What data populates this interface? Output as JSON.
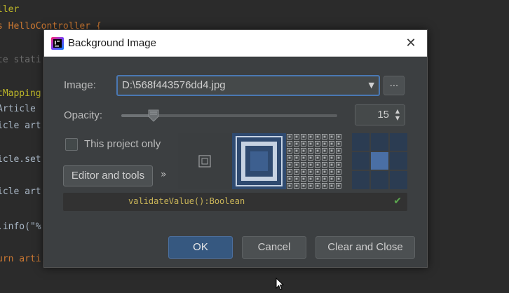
{
  "editor": {
    "lines": [
      {
        "prefix_class": "ann",
        "text": "ller"
      },
      {
        "prefix_class": "kw",
        "text": "s HelloController {"
      },
      {
        "prefix_class": "faded",
        "text": "te stati"
      },
      {
        "prefix_class": "ann",
        "text": "tMapping"
      },
      {
        "prefix_class": "",
        "text": "Article "
      },
      {
        "prefix_class": "",
        "text": "icle art"
      },
      {
        "prefix_class": "",
        "text": "icle.set"
      },
      {
        "prefix_class": "",
        "text": "icle art"
      },
      {
        "prefix_class": "",
        "text": ".info(\"%"
      },
      {
        "prefix_class": "kw",
        "text": "urn arti"
      }
    ]
  },
  "dialog": {
    "title": "Background Image",
    "close_glyph": "✕",
    "icon": "intellij-app-icon",
    "image_label": "Image:",
    "image_value": "D:\\568f443576dd4.jpg",
    "browse_label": "...",
    "opacity_label": "Opacity:",
    "opacity_value": "15",
    "opacity_fraction": 0.15,
    "this_project_only_label": "This project only",
    "this_project_only_checked": false,
    "editor_tools_label": "Editor and tools",
    "chevron_glyph": "»",
    "preview_code": "validateValue():Boolean",
    "ok_label": "OK",
    "cancel_label": "Cancel",
    "clear_close_label": "Clear and Close"
  },
  "colors": {
    "editor_bg": "#2b2b2b",
    "dialog_bg": "#3c3f41",
    "accent_blue": "#4a78b3",
    "ok_button": "#365880"
  }
}
